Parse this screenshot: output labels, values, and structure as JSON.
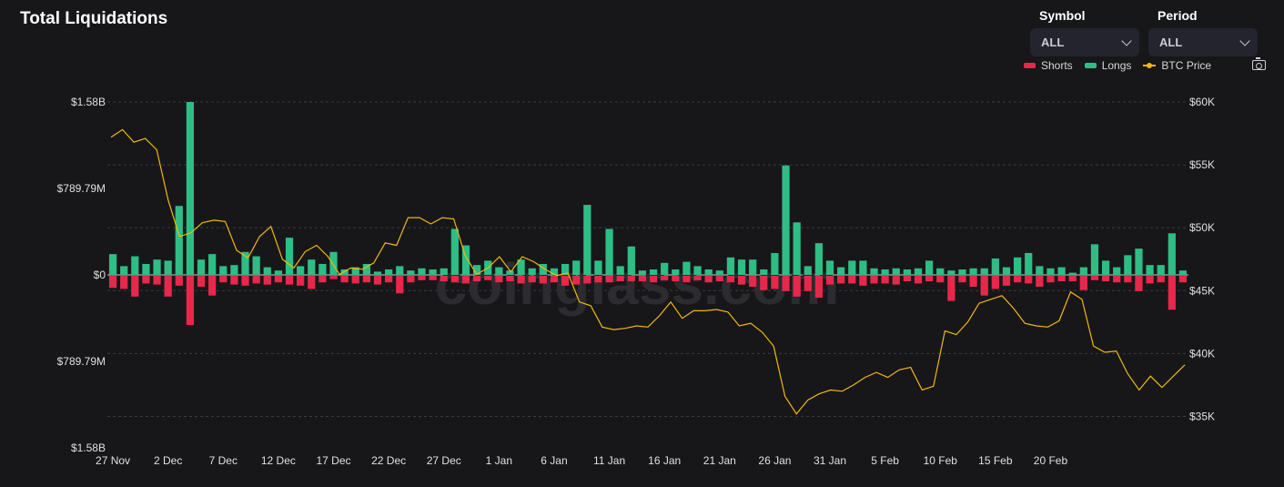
{
  "header": {
    "title": "Total Liquidations"
  },
  "controls": {
    "symbol": {
      "label": "Symbol",
      "value": "ALL"
    },
    "period": {
      "label": "Period",
      "value": "ALL"
    }
  },
  "legend": {
    "shorts": "Shorts",
    "longs": "Longs",
    "price": "BTC Price"
  },
  "colors": {
    "longs": "#2ebd85",
    "shorts": "#e8274b",
    "price": "#f0b90b",
    "grid": "#3a3a40",
    "background": "#17171a"
  },
  "watermark": "coinglass.com",
  "chart_data": {
    "type": "bar",
    "left_axis": {
      "ticks": [
        "$1.58B",
        "$789.79M",
        "$0",
        "$789.79M",
        "$1.58B"
      ],
      "ylim": [
        -1.58,
        1.58
      ],
      "unit": "B USD"
    },
    "right_axis": {
      "ticks": [
        "$60K",
        "$55K",
        "$50K",
        "$45K",
        "$40K",
        "$35K"
      ],
      "ylim": [
        32500,
        60000
      ]
    },
    "x_tick_labels": [
      "27 Nov",
      "2 Dec",
      "7 Dec",
      "12 Dec",
      "17 Dec",
      "22 Dec",
      "27 Dec",
      "1 Jan",
      "6 Jan",
      "11 Jan",
      "16 Jan",
      "21 Jan",
      "26 Jan",
      "31 Jan",
      "5 Feb",
      "10 Feb",
      "15 Feb",
      "20 Feb"
    ],
    "x_start": "27 Nov",
    "x_end": "25 Feb",
    "series": [
      {
        "name": "Longs",
        "values": [
          0.19,
          0.08,
          0.17,
          0.1,
          0.14,
          0.13,
          0.63,
          1.58,
          0.14,
          0.19,
          0.08,
          0.09,
          0.21,
          0.17,
          0.07,
          0.04,
          0.34,
          0.08,
          0.14,
          0.1,
          0.21,
          0.05,
          0.07,
          0.1,
          0.03,
          0.05,
          0.08,
          0.04,
          0.06,
          0.05,
          0.06,
          0.42,
          0.27,
          0.09,
          0.13,
          0.07,
          0.04,
          0.14,
          0.06,
          0.1,
          0.06,
          0.1,
          0.13,
          0.64,
          0.13,
          0.42,
          0.08,
          0.26,
          0.04,
          0.05,
          0.11,
          0.05,
          0.12,
          0.08,
          0.05,
          0.04,
          0.16,
          0.14,
          0.14,
          0.05,
          0.2,
          1.0,
          0.48,
          0.08,
          0.29,
          0.13,
          0.07,
          0.13,
          0.13,
          0.06,
          0.05,
          0.06,
          0.05,
          0.06,
          0.13,
          0.06,
          0.04,
          0.05,
          0.06,
          0.06,
          0.15,
          0.07,
          0.16,
          0.2,
          0.08,
          0.06,
          0.07,
          0.02,
          0.07,
          0.28,
          0.13,
          0.07,
          0.18,
          0.24,
          0.09,
          0.09,
          0.38,
          0.04
        ]
      },
      {
        "name": "Shorts",
        "values": [
          -0.11,
          -0.12,
          -0.19,
          -0.07,
          -0.08,
          -0.19,
          -0.09,
          -0.45,
          -0.1,
          -0.18,
          -0.06,
          -0.08,
          -0.09,
          -0.07,
          -0.08,
          -0.06,
          -0.08,
          -0.09,
          -0.12,
          -0.06,
          -0.03,
          -0.06,
          -0.07,
          -0.06,
          -0.08,
          -0.06,
          -0.16,
          -0.06,
          -0.04,
          -0.04,
          -0.05,
          -0.06,
          -0.07,
          -0.05,
          -0.04,
          -0.06,
          -0.05,
          -0.07,
          -0.06,
          -0.07,
          -0.06,
          -0.09,
          -0.08,
          -0.07,
          -0.06,
          -0.06,
          -0.05,
          -0.05,
          -0.05,
          -0.06,
          -0.04,
          -0.05,
          -0.06,
          -0.04,
          -0.06,
          -0.05,
          -0.06,
          -0.08,
          -0.1,
          -0.13,
          -0.12,
          -0.14,
          -0.19,
          -0.14,
          -0.2,
          -0.08,
          -0.07,
          -0.07,
          -0.09,
          -0.07,
          -0.07,
          -0.08,
          -0.05,
          -0.07,
          -0.05,
          -0.06,
          -0.23,
          -0.06,
          -0.1,
          -0.18,
          -0.12,
          -0.09,
          -0.06,
          -0.07,
          -0.1,
          -0.06,
          -0.05,
          -0.05,
          -0.13,
          -0.04,
          -0.05,
          -0.06,
          -0.06,
          -0.14,
          -0.07,
          -0.06,
          -0.31,
          -0.06
        ]
      },
      {
        "name": "BTC Price",
        "axis": "right",
        "values": [
          57200,
          57800,
          56800,
          57100,
          56200,
          52200,
          49300,
          49600,
          50400,
          50600,
          50500,
          48200,
          47600,
          49300,
          50100,
          47500,
          46800,
          48100,
          48600,
          47700,
          46300,
          46800,
          46700,
          47200,
          48800,
          48600,
          50800,
          50800,
          50300,
          50800,
          50700,
          47800,
          46300,
          46800,
          47700,
          46500,
          47700,
          47300,
          46700,
          46200,
          46400,
          44100,
          43800,
          42100,
          41900,
          42000,
          42200,
          42100,
          43000,
          44100,
          42800,
          43400,
          43400,
          43500,
          43300,
          42200,
          42400,
          41700,
          40600,
          36600,
          35200,
          36300,
          36800,
          37100,
          37000,
          37500,
          38100,
          38500,
          38100,
          38700,
          38900,
          37100,
          37400,
          41800,
          41500,
          42500,
          44000,
          44300,
          44600,
          43600,
          42400,
          42200,
          42100,
          42600,
          44900,
          44300,
          40600,
          40100,
          40200,
          38400,
          37100,
          38200,
          37300,
          38200,
          39100
        ]
      }
    ]
  }
}
